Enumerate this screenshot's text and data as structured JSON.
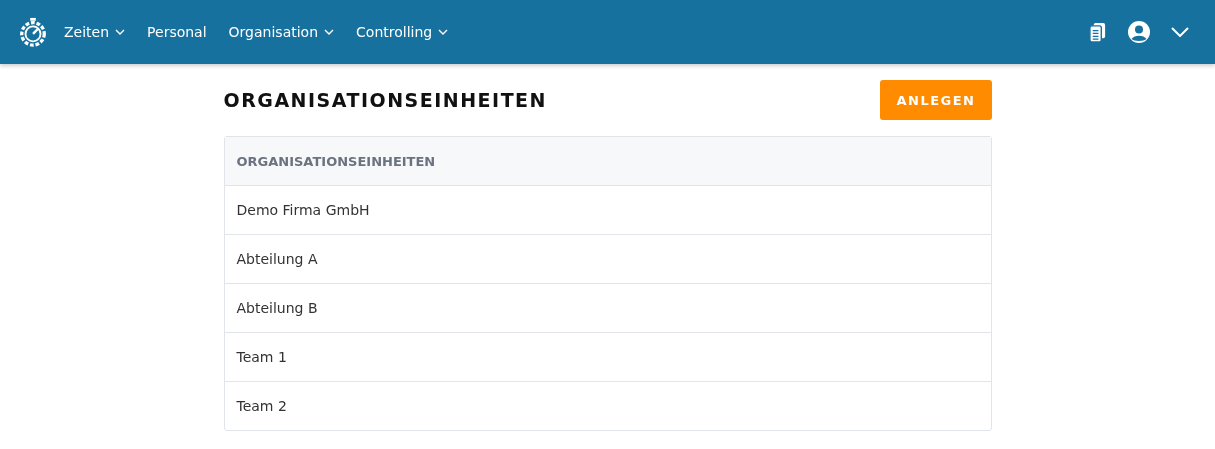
{
  "nav": {
    "items": [
      {
        "label": "Zeiten",
        "dropdown": true
      },
      {
        "label": "Personal",
        "dropdown": false
      },
      {
        "label": "Organisation",
        "dropdown": true
      },
      {
        "label": "Controlling",
        "dropdown": true
      }
    ]
  },
  "page": {
    "title": "ORGANISATIONSEINHEITEN",
    "create_button": "ANLEGEN"
  },
  "table": {
    "columns": [
      "ORGANISATIONSEINHEITEN"
    ],
    "rows": [
      "Demo Firma GmbH",
      "Abteilung A",
      "Abteilung B",
      "Team 1",
      "Team 2"
    ]
  }
}
